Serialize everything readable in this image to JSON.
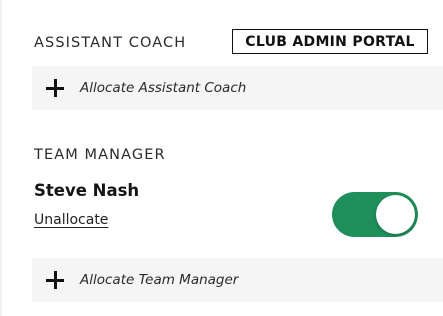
{
  "portal_badge": "CLUB ADMIN PORTAL",
  "assistant_coach": {
    "heading": "ASSISTANT COACH",
    "allocate_label": "Allocate Assistant Coach"
  },
  "team_manager": {
    "heading": "TEAM MANAGER",
    "person_name": "Steve Nash",
    "unallocate_label": "Unallocate",
    "toggle_on": true,
    "allocate_label": "Allocate Team Manager"
  },
  "colors": {
    "toggle_on": "#1e8e5a",
    "row_background": "#f5f5f5"
  },
  "icons": {
    "plus": "plus-icon"
  }
}
